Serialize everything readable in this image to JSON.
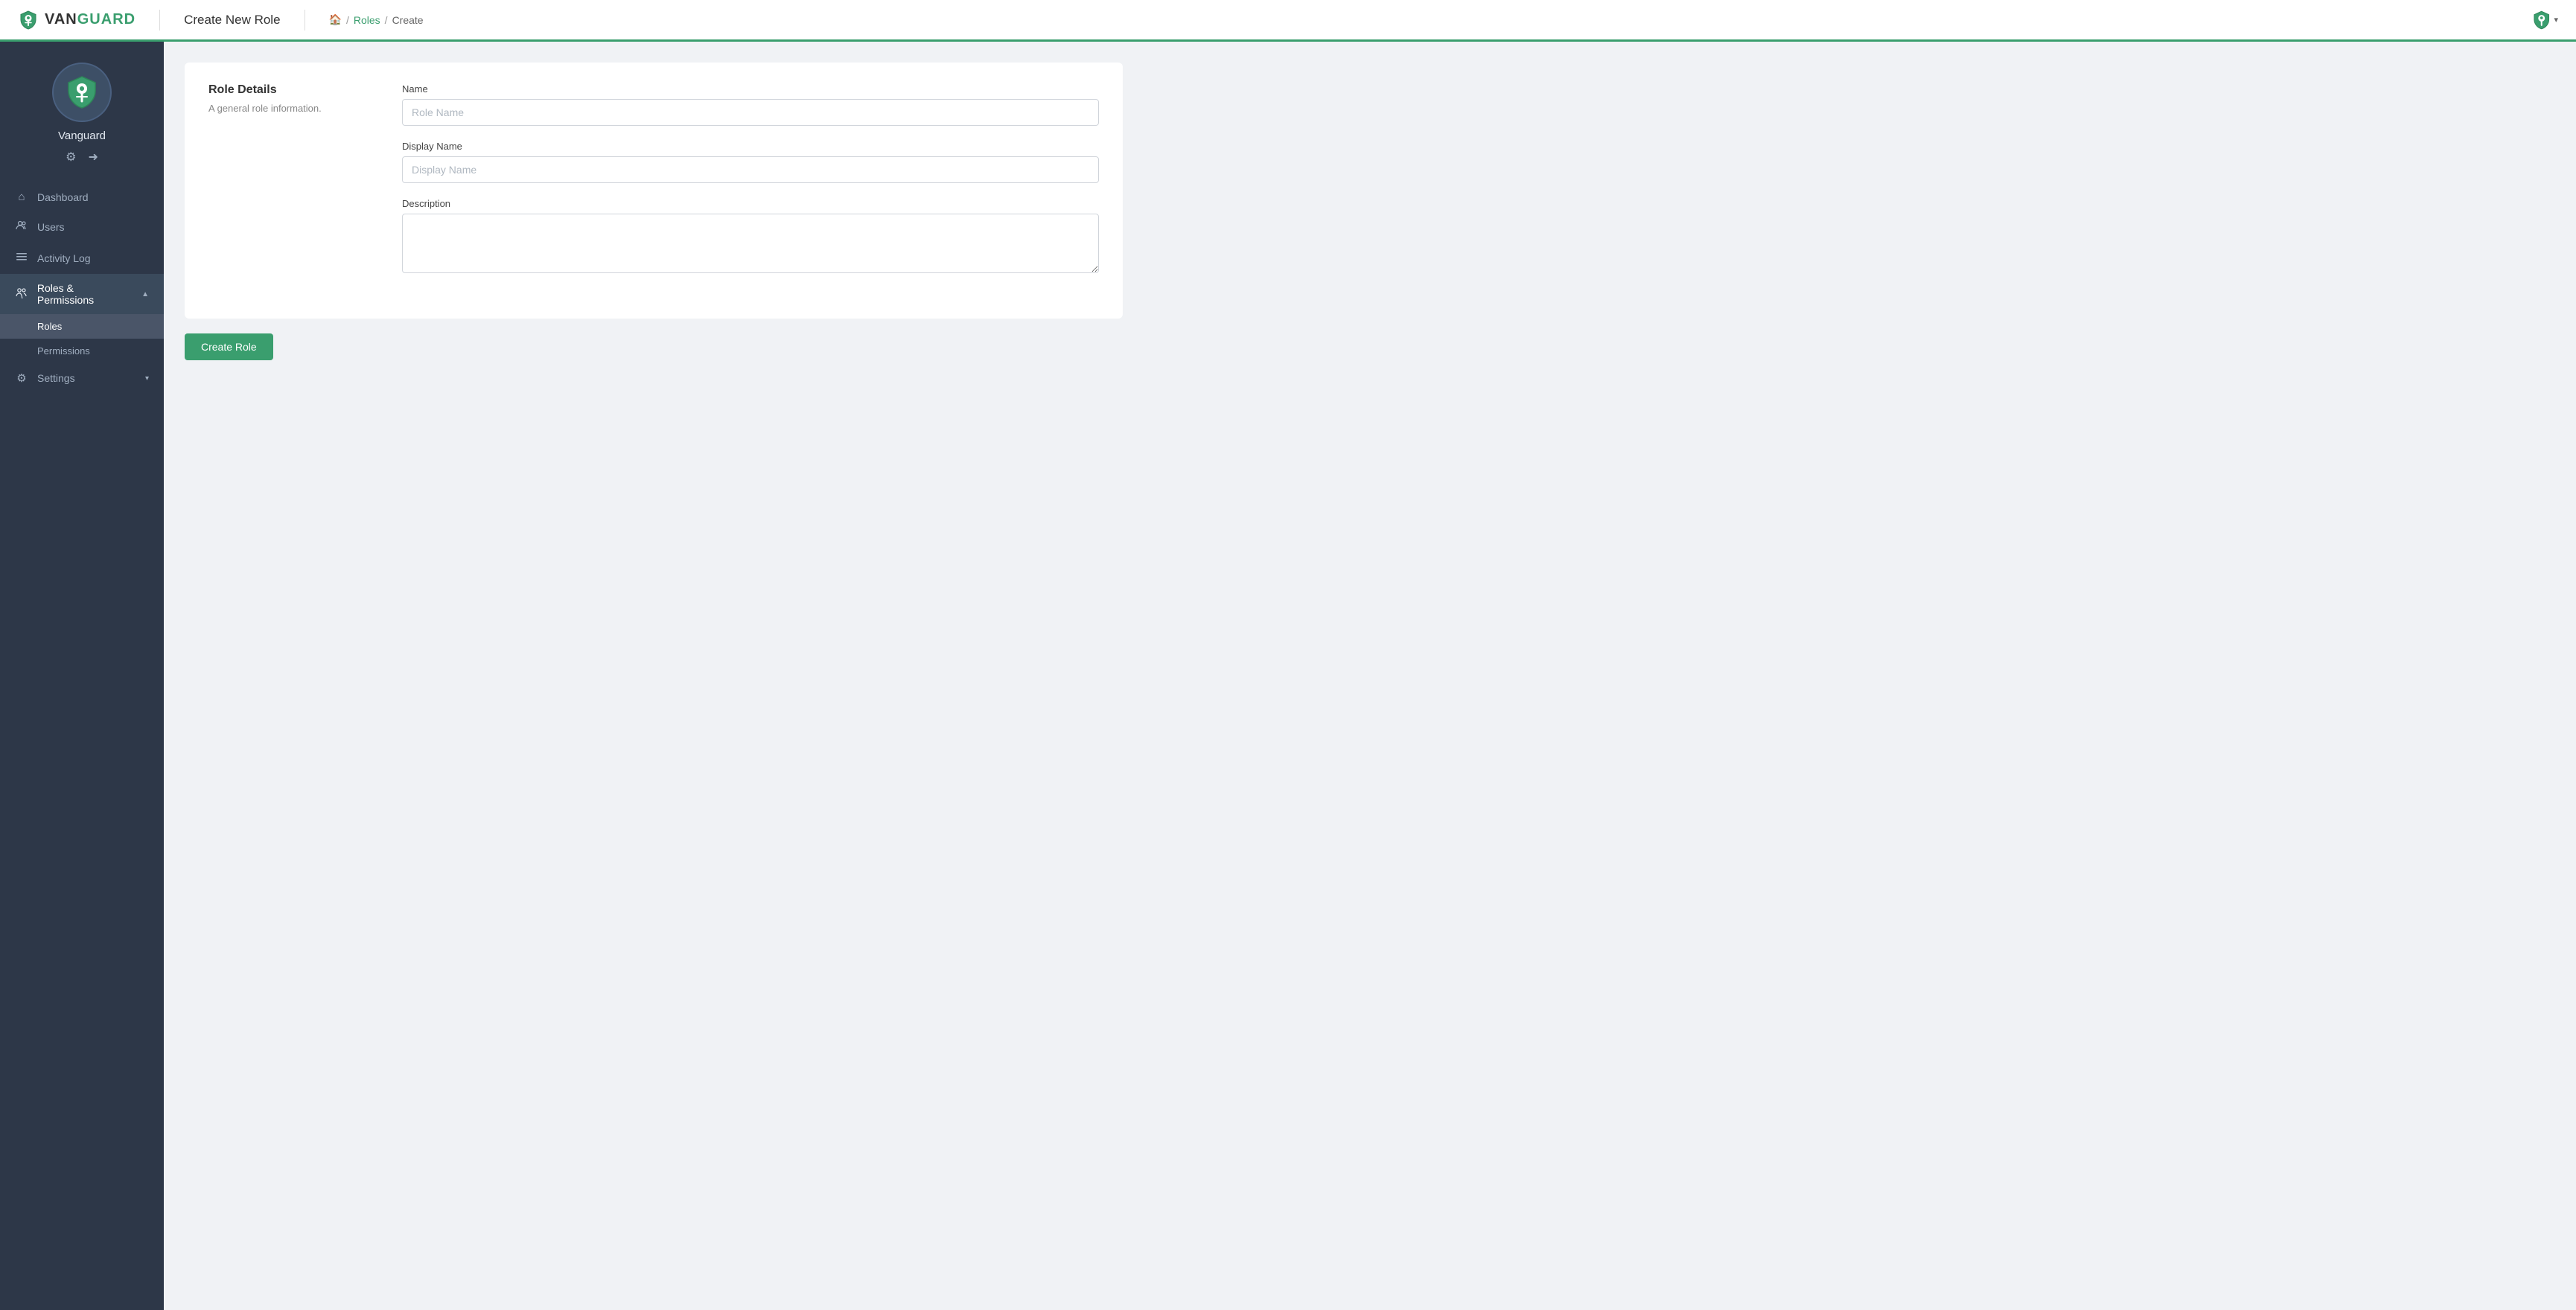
{
  "navbar": {
    "brand": "VANGUARD",
    "brand_prefix": "VAN",
    "brand_suffix": "GUARD",
    "page_title": "Create New Role",
    "breadcrumb": {
      "home_icon": "🏠",
      "separator": "/",
      "links": [
        "Roles"
      ],
      "current": "Create"
    },
    "avatar_dropdown_icon": "▾"
  },
  "sidebar": {
    "username": "Vanguard",
    "gear_icon": "⚙",
    "logout_icon": "➜",
    "nav_items": [
      {
        "id": "dashboard",
        "label": "Dashboard",
        "icon": "⌂"
      },
      {
        "id": "users",
        "label": "Users",
        "icon": "👥"
      },
      {
        "id": "activity-log",
        "label": "Activity Log",
        "icon": "☰"
      },
      {
        "id": "roles-permissions",
        "label": "Roles & Permissions",
        "icon": "👤",
        "has_arrow": true,
        "expanded": true
      },
      {
        "id": "settings",
        "label": "Settings",
        "icon": "⚙",
        "has_arrow": true
      }
    ],
    "sub_items": [
      {
        "id": "roles",
        "label": "Roles",
        "active": true
      },
      {
        "id": "permissions",
        "label": "Permissions"
      }
    ]
  },
  "form": {
    "section_title": "Role Details",
    "section_desc": "A general role information.",
    "name_label": "Name",
    "name_placeholder": "Role Name",
    "display_name_label": "Display Name",
    "display_name_placeholder": "Display Name",
    "description_label": "Description",
    "description_placeholder": "",
    "create_button": "Create Role"
  },
  "colors": {
    "green": "#3a9e6e",
    "sidebar_bg": "#2d3748",
    "nav_active": "#3a4a5c"
  }
}
